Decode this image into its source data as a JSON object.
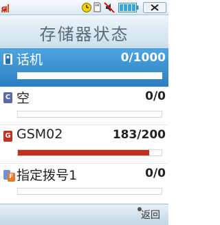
{
  "title": "存储器状态",
  "status": {
    "signal_icon": "signal-strength-icon",
    "alarm_icon": "alarm-clock-icon",
    "sd_icon": "memory-card-icon",
    "mute_icon": "mute-icon",
    "battery_icon": "battery-icon",
    "close_icon": "close-icon",
    "signal_letter": "G"
  },
  "rows": [
    {
      "icon_letter": "",
      "name": "话机",
      "count": "0/1000",
      "fill": 0,
      "icon_color": "#1f6fb5"
    },
    {
      "icon_letter": "C",
      "name": "空",
      "count": "0/0",
      "fill": 0,
      "icon_color": "#5c6aa8"
    },
    {
      "icon_letter": "G",
      "name": "GSM02",
      "count": "183/200",
      "fill": 0.915,
      "icon_color": "#c0311e"
    },
    {
      "icon_letter": "F",
      "name": "指定拨号1",
      "count": "0/0",
      "fill": 0,
      "icon_color": "#6b93d6"
    }
  ],
  "softkeys": {
    "back_label": "返回"
  }
}
